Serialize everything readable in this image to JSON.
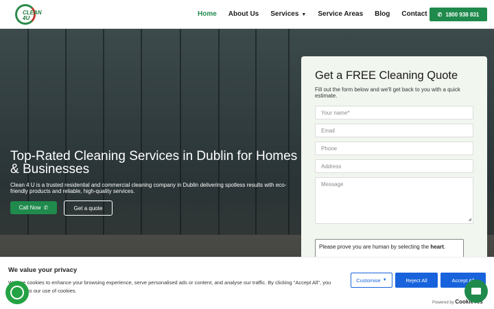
{
  "header": {
    "logo_text": "CLEAN 4U",
    "nav": [
      {
        "label": "Home"
      },
      {
        "label": "About Us"
      },
      {
        "label": "Services"
      },
      {
        "label": "Service Areas"
      },
      {
        "label": "Blog"
      },
      {
        "label": "Contact Us"
      }
    ],
    "phone": "1800 938 831"
  },
  "hero": {
    "title": "Top-Rated Cleaning Services in Dublin for Homes & Businesses",
    "subtitle": "Clean 4 U is a trusted residential and commercial cleaning company in Dublin delivering spotless results with eco-friendly products and reliable, high-quality services.",
    "call_label": "Call Now",
    "quote_label": "Get a quote"
  },
  "form": {
    "title": "Get a FREE Cleaning Quote",
    "description": "Fill out the form below and we'll get back to you with a quick estimate.",
    "name_placeholder": "Your name*",
    "email_placeholder": "Email",
    "phone_placeholder": "Phone",
    "address_placeholder": "Address",
    "message_placeholder": "Message",
    "captcha_text": "Please prove you are human by selecting the",
    "captcha_target": "heart"
  },
  "cookie": {
    "title": "We value your privacy",
    "text": "We use cookies to enhance your browsing experience, serve personalised ads or content, and analyse our traffic. By clicking \"Accept All\", you consent to our use of cookies.",
    "customise_label": "Customise",
    "reject_label": "Reject All",
    "accept_label": "Accept All",
    "powered_by": "Powered by",
    "brand": "CookieYes"
  },
  "colors": {
    "brand_green": "#1f8a4c",
    "cookie_blue": "#1863dc"
  }
}
